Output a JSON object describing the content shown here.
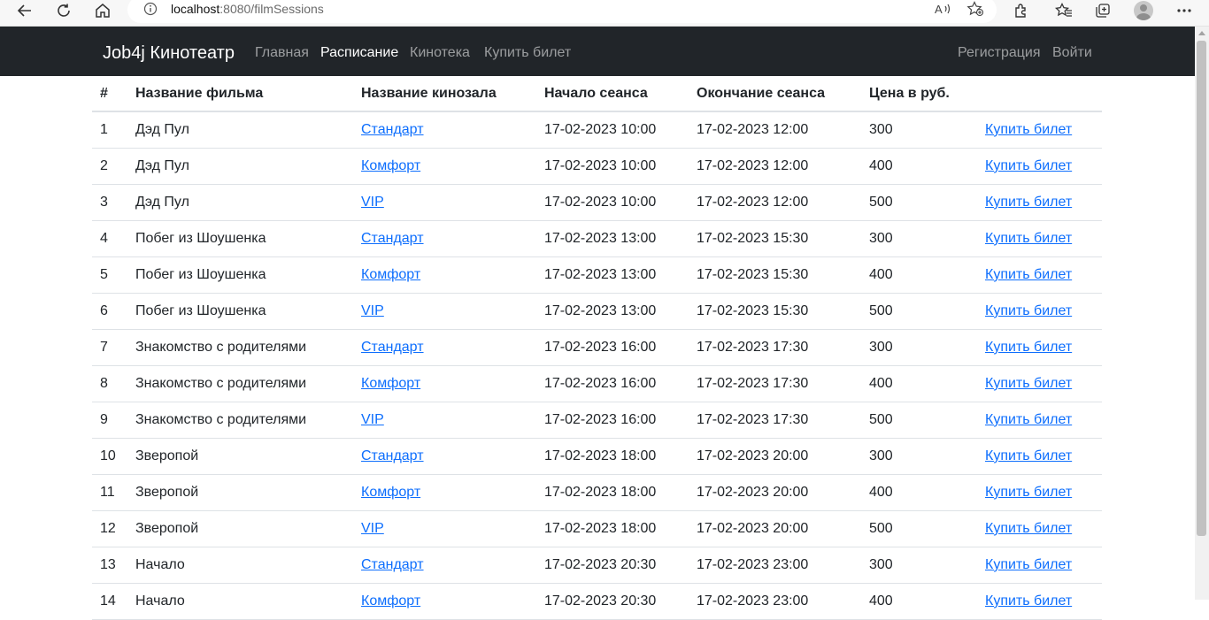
{
  "browser": {
    "url_host": "localhost",
    "url_path": ":8080/filmSessions"
  },
  "navbar": {
    "brand": "Job4j Кинотеатр",
    "links": [
      {
        "label": "Главная"
      },
      {
        "label": "Расписание",
        "active": true
      },
      {
        "label": "Кинотека"
      },
      {
        "label": "Купить билет"
      }
    ],
    "right": {
      "register": "Регистрация",
      "login": "Войти"
    }
  },
  "table": {
    "headers": [
      "#",
      "Название фильма",
      "Название кинозала",
      "Начало сеанса",
      "Окончание сеанса",
      "Цена в руб.",
      ""
    ],
    "rows": [
      {
        "num": "1",
        "film": "Дэд Пул",
        "hall": "Стандарт",
        "start": "17-02-2023 10:00",
        "end": "17-02-2023 12:00",
        "price": "300",
        "buy": "Купить билет"
      },
      {
        "num": "2",
        "film": "Дэд Пул",
        "hall": "Комфорт",
        "start": "17-02-2023 10:00",
        "end": "17-02-2023 12:00",
        "price": "400",
        "buy": "Купить билет"
      },
      {
        "num": "3",
        "film": "Дэд Пул",
        "hall": "VIP",
        "start": "17-02-2023 10:00",
        "end": "17-02-2023 12:00",
        "price": "500",
        "buy": "Купить билет"
      },
      {
        "num": "4",
        "film": "Побег из Шоушенка",
        "hall": "Стандарт",
        "start": "17-02-2023 13:00",
        "end": "17-02-2023 15:30",
        "price": "300",
        "buy": "Купить билет"
      },
      {
        "num": "5",
        "film": "Побег из Шоушенка",
        "hall": "Комфорт",
        "start": "17-02-2023 13:00",
        "end": "17-02-2023 15:30",
        "price": "400",
        "buy": "Купить билет"
      },
      {
        "num": "6",
        "film": "Побег из Шоушенка",
        "hall": "VIP",
        "start": "17-02-2023 13:00",
        "end": "17-02-2023 15:30",
        "price": "500",
        "buy": "Купить билет"
      },
      {
        "num": "7",
        "film": "Знакомство с родителями",
        "hall": "Стандарт",
        "start": "17-02-2023 16:00",
        "end": "17-02-2023 17:30",
        "price": "300",
        "buy": "Купить билет"
      },
      {
        "num": "8",
        "film": "Знакомство с родителями",
        "hall": "Комфорт",
        "start": "17-02-2023 16:00",
        "end": "17-02-2023 17:30",
        "price": "400",
        "buy": "Купить билет"
      },
      {
        "num": "9",
        "film": "Знакомство с родителями",
        "hall": "VIP",
        "start": "17-02-2023 16:00",
        "end": "17-02-2023 17:30",
        "price": "500",
        "buy": "Купить билет"
      },
      {
        "num": "10",
        "film": "Зверопой",
        "hall": "Стандарт",
        "start": "17-02-2023 18:00",
        "end": "17-02-2023 20:00",
        "price": "300",
        "buy": "Купить билет"
      },
      {
        "num": "11",
        "film": "Зверопой",
        "hall": "Комфорт",
        "start": "17-02-2023 18:00",
        "end": "17-02-2023 20:00",
        "price": "400",
        "buy": "Купить билет"
      },
      {
        "num": "12",
        "film": "Зверопой",
        "hall": "VIP",
        "start": "17-02-2023 18:00",
        "end": "17-02-2023 20:00",
        "price": "500",
        "buy": "Купить билет"
      },
      {
        "num": "13",
        "film": "Начало",
        "hall": "Стандарт",
        "start": "17-02-2023 20:30",
        "end": "17-02-2023 23:00",
        "price": "300",
        "buy": "Купить билет"
      },
      {
        "num": "14",
        "film": "Начало",
        "hall": "Комфорт",
        "start": "17-02-2023 20:30",
        "end": "17-02-2023 23:00",
        "price": "400",
        "buy": "Купить билет"
      }
    ]
  },
  "colors": {
    "navbar_bg": "#212529",
    "link": "#0d6efd",
    "border": "#dee2e6"
  },
  "icons": [
    "back-arrow-icon",
    "refresh-icon",
    "home-icon",
    "info-icon",
    "read-aloud-icon",
    "favorite-add-icon",
    "extensions-icon",
    "favorites-icon",
    "collections-icon",
    "profile-icon",
    "more-icon"
  ]
}
